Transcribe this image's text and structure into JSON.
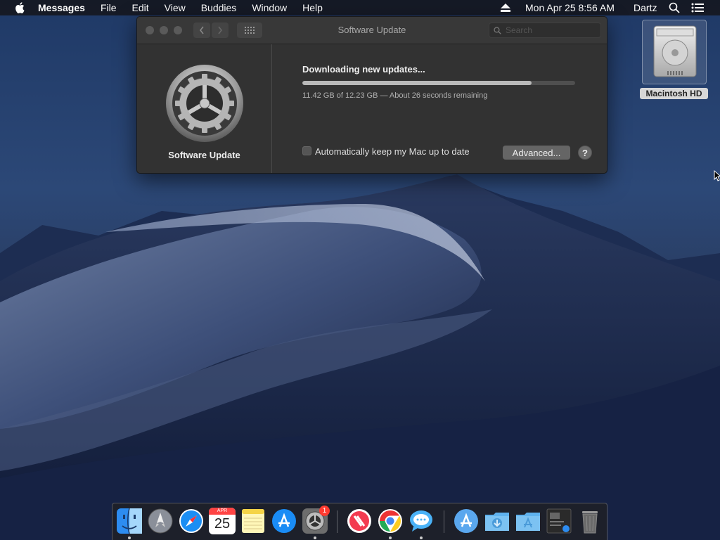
{
  "menubar": {
    "app_name": "Messages",
    "items": [
      "File",
      "Edit",
      "View",
      "Buddies",
      "Window",
      "Help"
    ],
    "clock": "Mon Apr 25  8:56 AM",
    "user": "Dartz"
  },
  "window": {
    "title": "Software Update",
    "search_placeholder": "Search",
    "sidebar_label": "Software Update",
    "status_title": "Downloading new updates...",
    "progress_fraction": 0.84,
    "progress_text": "11.42 GB of 12.23 GB — About 26 seconds remaining",
    "auto_update_label": "Automatically keep my Mac up to date",
    "auto_update_checked": false,
    "advanced_button": "Advanced...",
    "help_button": "?"
  },
  "desktop_icon": {
    "label": "Macintosh HD"
  },
  "dock": {
    "calendar_month": "APR",
    "calendar_day": "25",
    "system_prefs_badge": "1",
    "apps": [
      "finder-icon",
      "launchpad-icon",
      "safari-icon",
      "calendar-icon",
      "notes-icon",
      "app-store-icon",
      "system-preferences-icon",
      "news-icon",
      "chrome-icon",
      "messages-icon",
      "applications-folder-icon",
      "downloads-folder-icon",
      "documents-folder-icon",
      "screen-sharing-icon",
      "trash-icon"
    ]
  },
  "colors": {
    "window_bg": "#323232",
    "progress_fill": "#b9b9b9",
    "badge": "#ff3b30"
  }
}
